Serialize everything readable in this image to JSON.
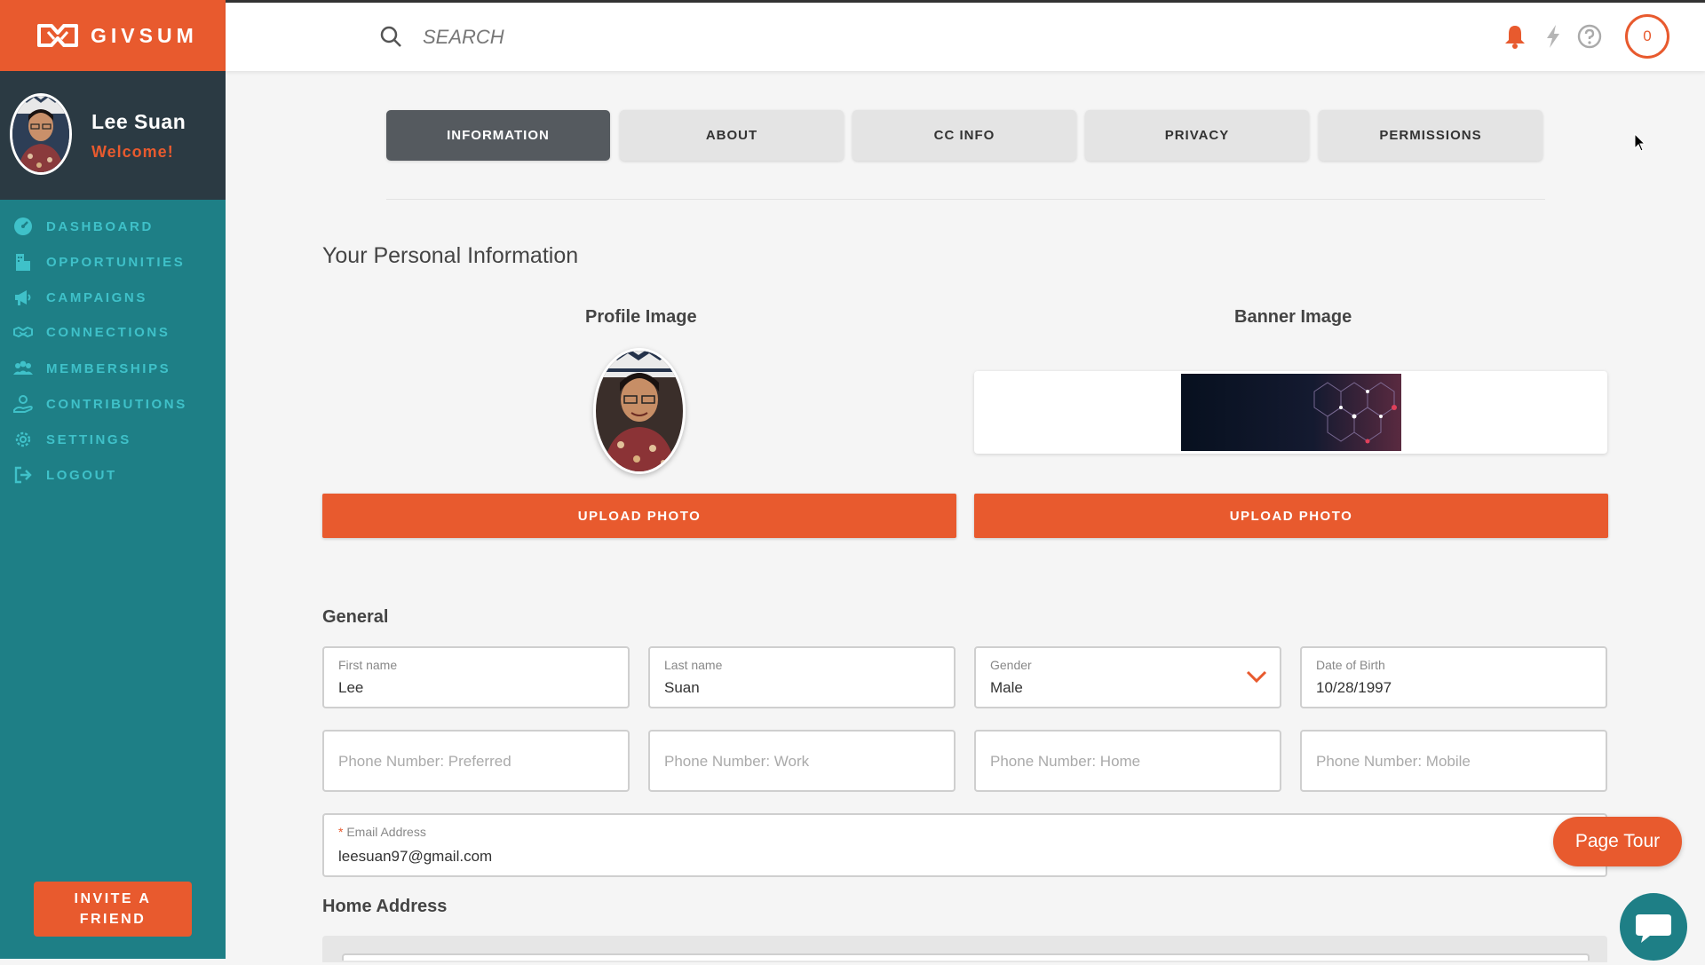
{
  "brand": {
    "name": "GIVSUM"
  },
  "user": {
    "name": "Lee Suan",
    "greeting": "Welcome!"
  },
  "sidebar": {
    "items": [
      {
        "label": "DASHBOARD",
        "icon": "dashboard-icon"
      },
      {
        "label": "OPPORTUNITIES",
        "icon": "opportunities-icon"
      },
      {
        "label": "CAMPAIGNS",
        "icon": "megaphone-icon"
      },
      {
        "label": "CONNECTIONS",
        "icon": "handshake-icon"
      },
      {
        "label": "MEMBERSHIPS",
        "icon": "group-icon"
      },
      {
        "label": "CONTRIBUTIONS",
        "icon": "hand-heart-icon"
      },
      {
        "label": "SETTINGS",
        "icon": "gear-icon"
      },
      {
        "label": "LOGOUT",
        "icon": "logout-icon"
      }
    ],
    "invite_label_line1": "INVITE A",
    "invite_label_line2": "FRIEND"
  },
  "header": {
    "search_placeholder": "SEARCH",
    "counter": "0"
  },
  "tabs": [
    {
      "label": "INFORMATION",
      "active": true
    },
    {
      "label": "ABOUT",
      "active": false
    },
    {
      "label": "CC INFO",
      "active": false
    },
    {
      "label": "PRIVACY",
      "active": false
    },
    {
      "label": "PERMISSIONS",
      "active": false
    }
  ],
  "main": {
    "section_title": "Your Personal Information",
    "profile_image_label": "Profile Image",
    "banner_image_label": "Banner Image",
    "upload_label": "UPLOAD PHOTO",
    "general_title": "General",
    "home_address_title": "Home Address"
  },
  "form": {
    "first_name": {
      "label": "First name",
      "value": "Lee"
    },
    "last_name": {
      "label": "Last name",
      "value": "Suan"
    },
    "gender": {
      "label": "Gender",
      "value": "Male"
    },
    "dob": {
      "label": "Date of Birth",
      "value": "10/28/1997"
    },
    "phone_preferred": {
      "placeholder": "Phone Number: Preferred"
    },
    "phone_work": {
      "placeholder": "Phone Number: Work"
    },
    "phone_home": {
      "placeholder": "Phone Number: Home"
    },
    "phone_mobile": {
      "placeholder": "Phone Number: Mobile"
    },
    "email": {
      "required_mark": "*",
      "label": "Email Address",
      "value": "leesuan97@gmail.com"
    }
  },
  "page_tour_label": "Page Tour",
  "colors": {
    "brand_orange": "#e85a2e",
    "sidebar_teal": "#1e7f86",
    "nav_text": "#3fc1c9",
    "profile_dark": "#2b3a43"
  }
}
